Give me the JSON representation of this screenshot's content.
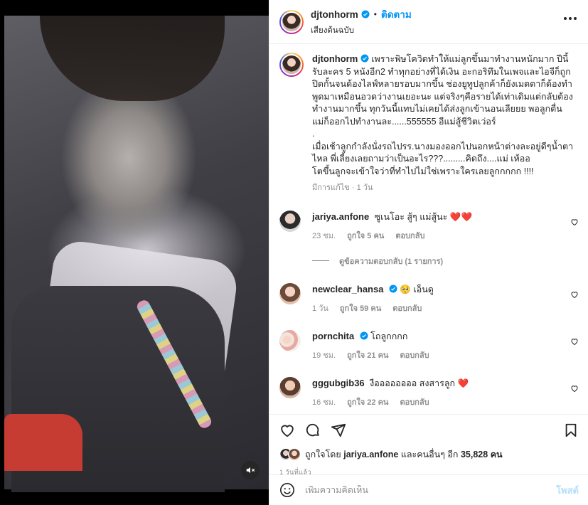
{
  "post": {
    "username": "djtonhorm",
    "follow_label": "ติดตาม",
    "dot": "•",
    "audio_label": "เสียงต้นฉบับ",
    "mute_icon": "speaker-muted-icon",
    "caption_username": "djtonhorm",
    "caption_text": "เพราะพิษโควิดทำให้แม่ลูกขึ้นมาทำงานหนักมาก ปีนี้รับละคร 5 หนังอีก2 ทำทุกอย่างที่ได้เงิน อะกอริทึมในเพจและไอจีก็ถูกปิดกั้นจนต้องไลฟ์หลายรอบมากขึ้น ช่องยูทูปลูกค้าก็ยังเมตตาก็ต้องทำ พูดมาเหมือนอวดว่างานเยอะนะ แต่จริงๆคือรายได้เท่าเดิมแต่กลับต้องทำงานมากขึ้น ทุกวันนี้แทบไม่เคยได้ส่งลูกเข้านอนเลียยย พอลูกตื่นแม่ก็ออกไปทำงานละ......555555 อีแม่สู้ชีวิตเว่อร์\n.\nเมื่อเช้าลูกกำลังนั่งรถไปรร.นางมองออกไปนอกหน้าต่างละอยู่ดีๆน้ำตาไหล พี่เลี้ยงเลยถามว่าเป็นอะไร???.........คิดถึง....แม่ เห้ออ\nโตขึ้นลูกจะเข้าใจว่าที่ทำไปไม่ใช่เพราะใครเลยลูกกกกก !!!!",
    "caption_meta": "มีการแก้ไข · 1 วัน"
  },
  "comments": [
    {
      "username": "jariya.anfone",
      "verified": false,
      "text": "ซูเนโอะ สู้ๆ แม่สู้นะ",
      "emoji": "❤️❤️",
      "time": "23 ชม.",
      "likes": "ถูกใจ 5 คน",
      "reply": "ตอบกลับ"
    },
    {
      "username": "newclear_hansa",
      "verified": true,
      "text": "เอ็นดู",
      "emoji_pre": "🥺",
      "time": "1 วัน",
      "likes": "ถูกใจ 59 คน",
      "reply": "ตอบกลับ"
    },
    {
      "username": "pornchita",
      "verified": true,
      "text": "โถลูกกกก",
      "time": "19 ชม.",
      "likes": "ถูกใจ 21 คน",
      "reply": "ตอบกลับ"
    },
    {
      "username": "gggubgib36",
      "verified": false,
      "text": "งืออออออออ สงสารลูก",
      "emoji": "❤️",
      "time": "16 ชม.",
      "likes": "ถูกใจ 22 คน",
      "reply": "ตอบกลับ"
    }
  ],
  "view_replies": "ดูข้อความตอบกลับ (1 รายการ)",
  "actions": {
    "icons": [
      "heart-icon",
      "comment-icon",
      "share-icon",
      "bookmark-icon"
    ],
    "liked_by_prefix": "ถูกใจโดย",
    "liked_by_user": "jariya.anfone",
    "liked_by_and": "และคนอื่นๆ อีก",
    "liked_by_count": "35,828",
    "liked_by_suffix": "คน",
    "time_ago": "1 วันที่แล้ว"
  },
  "add_comment": {
    "placeholder": "เพิ่มความคิดเห็น",
    "post_label": "โพสต์"
  },
  "colors": {
    "link_blue": "#0095f6",
    "post_disabled": "#b2dffc",
    "heart_red": "#ed4956",
    "muted_text": "#8e8e8e"
  }
}
